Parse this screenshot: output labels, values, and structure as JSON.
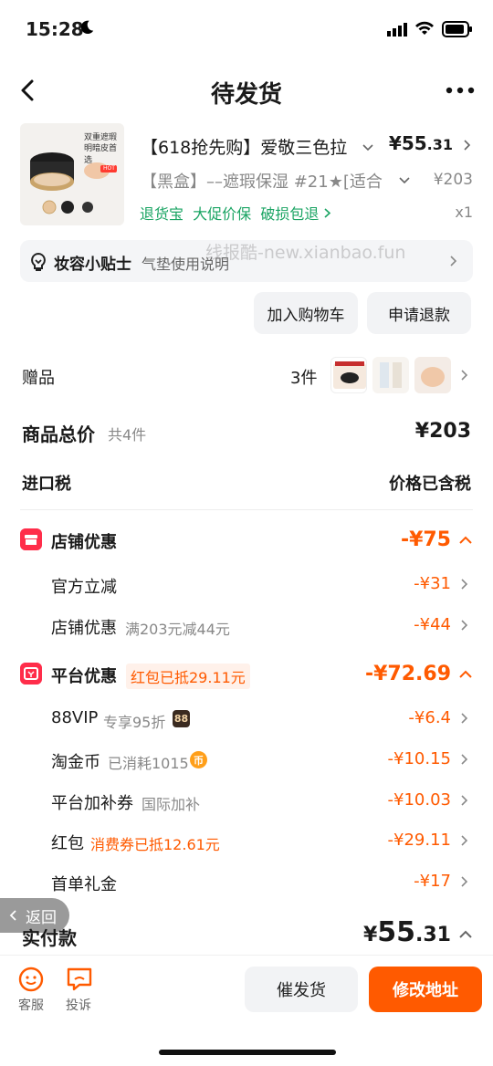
{
  "status": {
    "time": "15:28"
  },
  "nav": {
    "title": "待发货"
  },
  "product": {
    "title": "【618抢先购】爱敬三色拉",
    "price_int": "¥55",
    "price_dec": ".31",
    "sku": "【黑盒】––遮瑕保湿 #21★[适合",
    "original_price": "¥203",
    "services": "退货宝  大促价保  破损包退",
    "quantity": "x1",
    "thumb_text_1": "双重遮瑕",
    "thumb_text_2": "明暗皮首选",
    "thumb_badge": "HOT"
  },
  "tip": {
    "title": "妆容小贴士",
    "text": "气垫使用说明",
    "watermark": "线报酷-new.xianbao.fun"
  },
  "actions": {
    "add_cart": "加入购物车",
    "refund": "申请退款"
  },
  "gift": {
    "label": "赠品",
    "count": "3件"
  },
  "total": {
    "label": "商品总价",
    "count": "共4件",
    "value": "¥203"
  },
  "tax": {
    "label": "进口税",
    "value": "价格已含税"
  },
  "store_discount": {
    "title": "店铺优惠",
    "amount": "-¥75",
    "items": [
      {
        "label": "官方立减",
        "note": "",
        "amount": "-¥31"
      },
      {
        "label": "店铺优惠",
        "note": "满203元减44元",
        "amount": "-¥44"
      }
    ]
  },
  "platform_discount": {
    "title": "平台优惠",
    "pill": "红包已抵29.11元",
    "amount": "-¥72.69",
    "items": [
      {
        "label": "88VIP",
        "note": "专享95折",
        "badge": "88",
        "amount": "-¥6.4"
      },
      {
        "label": "淘金币",
        "note": "已消耗1015",
        "badge": "币",
        "amount": "-¥10.15"
      },
      {
        "label": "平台加补券",
        "note": "国际加补",
        "amount": "-¥10.03"
      },
      {
        "label": "红包",
        "note": "消费券已抵12.61元",
        "amount": "-¥29.11"
      },
      {
        "label": "首单礼金",
        "note": "",
        "amount": "-¥17"
      }
    ]
  },
  "back_pill": "返回",
  "pay": {
    "label": "实付款",
    "currency": "¥",
    "int": "55",
    "dec": ".31"
  },
  "bottom": {
    "service": "客服",
    "complain": "投诉",
    "urge": "催发货",
    "change_address": "修改地址"
  },
  "colors": {
    "accent": "#ff5a00",
    "green": "#1aa463",
    "red_icon": "#ff2d4a"
  }
}
